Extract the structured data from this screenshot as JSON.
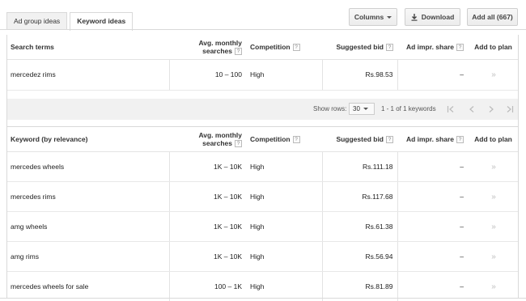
{
  "tabs": [
    {
      "label": "Ad group ideas"
    },
    {
      "label": "Keyword ideas"
    }
  ],
  "toolbar": {
    "columns_label": "Columns",
    "download_label": "Download",
    "add_all_label": "Add all (667)"
  },
  "headers": {
    "search_terms": "Search terms",
    "keyword": "Keyword (by relevance)",
    "avg_line1": "Avg. monthly",
    "avg_line2": "searches",
    "competition": "Competition",
    "suggested_bid": "Suggested bid",
    "ad_impr": "Ad impr. share",
    "add_to_plan": "Add to plan",
    "help": "?"
  },
  "search_term_row": {
    "keyword": "mercedez rims",
    "searches": "10 – 100",
    "competition": "High",
    "bid": "Rs.98.53",
    "share": "–",
    "add": "»"
  },
  "pager": {
    "show_rows_label": "Show rows:",
    "rows_value": "30",
    "range": "1 - 1 of 1 keywords"
  },
  "keyword_rows": [
    {
      "keyword": "mercedes wheels",
      "searches": "1K – 10K",
      "competition": "High",
      "bid": "Rs.111.18",
      "share": "–",
      "add": "»"
    },
    {
      "keyword": "mercedes rims",
      "searches": "1K – 10K",
      "competition": "High",
      "bid": "Rs.117.68",
      "share": "–",
      "add": "»"
    },
    {
      "keyword": "amg wheels",
      "searches": "1K – 10K",
      "competition": "High",
      "bid": "Rs.61.38",
      "share": "–",
      "add": "»"
    },
    {
      "keyword": "amg rims",
      "searches": "1K – 10K",
      "competition": "High",
      "bid": "Rs.56.94",
      "share": "–",
      "add": "»"
    },
    {
      "keyword": "mercedes wheels for sale",
      "searches": "100 – 1K",
      "competition": "High",
      "bid": "Rs.81.89",
      "share": "–",
      "add": "»"
    }
  ]
}
